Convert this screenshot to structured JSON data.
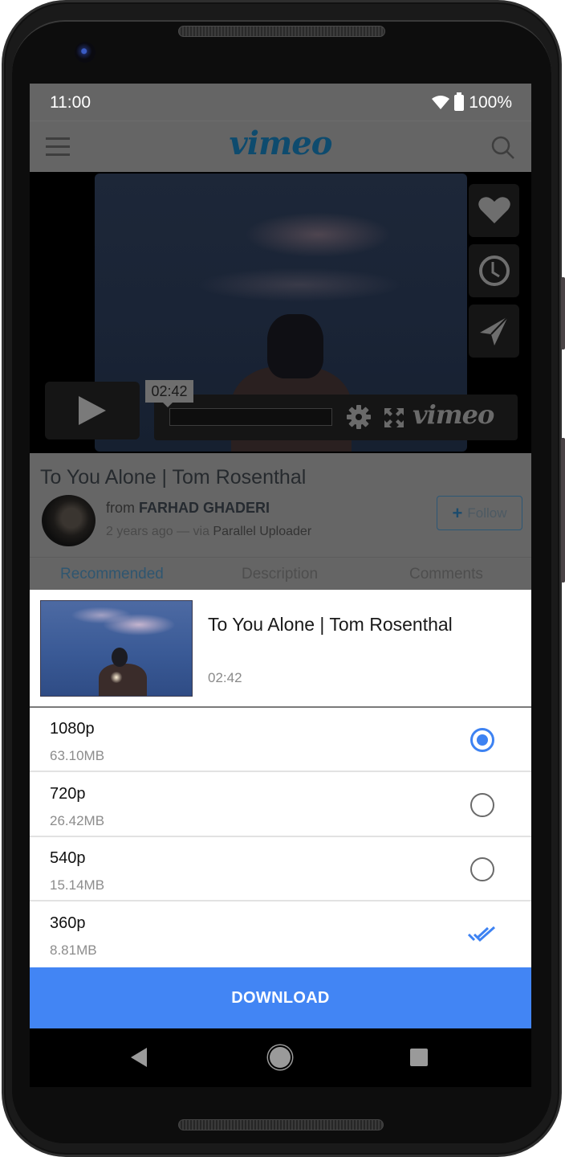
{
  "status_bar": {
    "time": "11:00",
    "battery": "100%",
    "icons": [
      "wifi-icon",
      "battery-icon"
    ]
  },
  "app_bar": {
    "logo": "vimeo",
    "icons": [
      "menu-icon",
      "search-icon"
    ]
  },
  "player": {
    "time_tooltip": "02:42",
    "logo": "vimeo",
    "side_actions": [
      "heart-icon",
      "clock-icon",
      "send-icon"
    ],
    "controls": [
      "play-icon",
      "gear-icon",
      "fullscreen-icon"
    ]
  },
  "video_info": {
    "title": "To You Alone | Tom Rosenthal",
    "from_prefix": "from",
    "author": "FARHAD GHADERI",
    "age": "2 years ago",
    "via_prefix": "— via",
    "via_app": "Parallel Uploader",
    "follow_label": "Follow"
  },
  "tabs": [
    {
      "label": "Recommended",
      "active": true
    },
    {
      "label": "Description",
      "active": false
    },
    {
      "label": "Comments",
      "active": false
    }
  ],
  "download_sheet": {
    "title": "To You Alone | Tom Rosenthal",
    "duration": "02:42",
    "options": [
      {
        "resolution": "1080p",
        "size": "63.10MB",
        "state": "selected"
      },
      {
        "resolution": "720p",
        "size": "26.42MB",
        "state": "unselected"
      },
      {
        "resolution": "540p",
        "size": "15.14MB",
        "state": "unselected"
      },
      {
        "resolution": "360p",
        "size": "8.81MB",
        "state": "downloaded"
      }
    ],
    "download_label": "DOWNLOAD"
  },
  "colors": {
    "accent": "#4285f4",
    "radio_selected": "#3d82f2",
    "vimeo_brand": "#0e4b6e"
  },
  "nav_bar": [
    "back-icon",
    "home-icon",
    "recents-icon"
  ]
}
